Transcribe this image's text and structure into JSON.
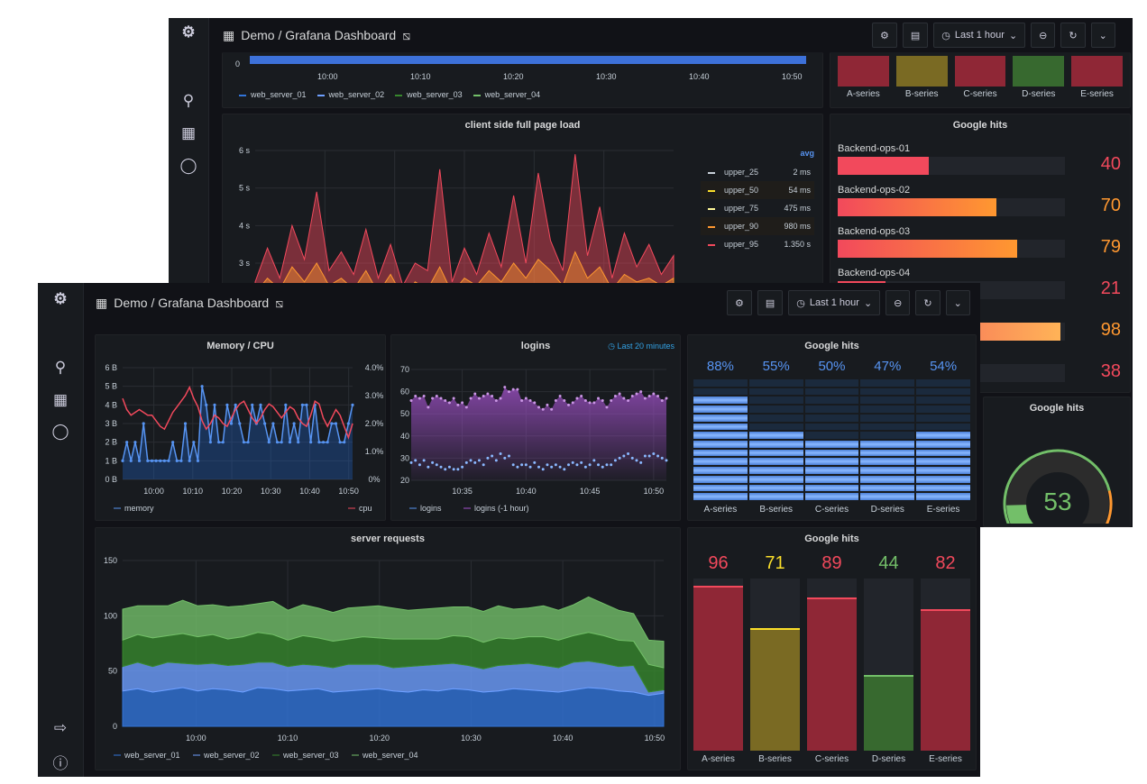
{
  "colors": {
    "bg": "#111217",
    "panel": "#181b1f",
    "blue": "#5794f2",
    "red": "#f2495c",
    "orange": "#ff9830",
    "yellow": "#fade2a",
    "green": "#73bf69",
    "purple": "#a352cc",
    "logo": "#f46800"
  },
  "back": {
    "breadcrumb": "Demo / Grafana Dashboard",
    "time_picker": "Last 1 hour",
    "top_panel": {
      "y_tick": "0",
      "x_ticks": [
        "10:00",
        "10:10",
        "10:20",
        "10:30",
        "10:40",
        "10:50"
      ],
      "legend": [
        "web_server_01",
        "web_server_02",
        "web_server_03",
        "web_server_04"
      ]
    },
    "status_panel": {
      "items": [
        {
          "label": "A-series",
          "color": "#8f2736"
        },
        {
          "label": "B-series",
          "color": "#7a6a23"
        },
        {
          "label": "C-series",
          "color": "#8f2736"
        },
        {
          "label": "D-series",
          "color": "#37692f"
        },
        {
          "label": "E-series",
          "color": "#8f2736"
        }
      ]
    },
    "page_load": {
      "title": "client side full page load",
      "legend_header": "avg",
      "legend": [
        {
          "name": "upper_25",
          "value": "2 ms",
          "color": "#c7d0d9"
        },
        {
          "name": "upper_50",
          "value": "54 ms",
          "color": "#fade2a"
        },
        {
          "name": "upper_75",
          "value": "475 ms",
          "color": "#fff899"
        },
        {
          "name": "upper_90",
          "value": "980 ms",
          "color": "#ff9830"
        },
        {
          "name": "upper_95",
          "value": "1.350 s",
          "color": "#f2495c"
        }
      ],
      "chart_data": {
        "type": "area",
        "y_ticks": [
          "3 s",
          "4 s",
          "5 s",
          "6 s"
        ],
        "ylim": [
          0,
          6
        ],
        "series": [
          {
            "name": "upper_95",
            "values": [
              2.5,
              3.4,
              2.6,
              4.0,
              3.1,
              4.9,
              2.8,
              3.3,
              2.7,
              3.9,
              2.6,
              3.5,
              2.4,
              3.0,
              2.8,
              5.5,
              2.5,
              3.4,
              2.7,
              3.8,
              2.9,
              4.8,
              3.0,
              5.4,
              3.6,
              2.8,
              5.9,
              3.2,
              4.5,
              2.6,
              3.8,
              2.9,
              3.5,
              2.7,
              3.2
            ]
          },
          {
            "name": "upper_90",
            "values": [
              2.2,
              2.6,
              2.3,
              2.9,
              2.5,
              3.0,
              2.4,
              2.6,
              2.3,
              2.8,
              2.2,
              2.7,
              2.1,
              2.5,
              2.3,
              2.9,
              2.2,
              2.6,
              2.4,
              2.8,
              2.5,
              3.0,
              2.6,
              3.1,
              2.8,
              2.4,
              3.3,
              2.6,
              2.9,
              2.3,
              2.7,
              2.5,
              2.6,
              2.4,
              2.6
            ]
          }
        ]
      }
    },
    "bar_gauge": {
      "title": "Google hits",
      "rows": [
        {
          "label": "Backend-ops-01",
          "value": 40
        },
        {
          "label": "Backend-ops-02",
          "value": 70
        },
        {
          "label": "Backend-ops-03",
          "value": 79
        },
        {
          "label": "Backend-ops-04",
          "value": 21
        },
        {
          "label": "",
          "value": 98
        },
        {
          "label": "",
          "value": 38
        }
      ]
    },
    "gauge": {
      "title": "Google hits",
      "value": 53,
      "max": 100
    }
  },
  "front": {
    "breadcrumb": "Demo / Grafana Dashboard",
    "time_picker": "Last 1 hour",
    "memory_cpu": {
      "title": "Memory / CPU",
      "chart_data": {
        "type": "line",
        "time_range": [
          "09:52",
          "10:51"
        ],
        "x_ticks": [
          "10:00",
          "10:10",
          "10:20",
          "10:30",
          "10:40",
          "10:50"
        ],
        "y_left_ticks": [
          "0 B",
          "1 B",
          "2 B",
          "3 B",
          "4 B",
          "5 B",
          "6 B"
        ],
        "ylim_left": [
          0,
          6
        ],
        "y_right_ticks": [
          "0%",
          "1.0%",
          "2.0%",
          "3.0%",
          "4.0%"
        ],
        "ylim_right": [
          0,
          4
        ],
        "series": [
          {
            "name": "memory",
            "axis": "left",
            "values": [
              1,
              2,
              1,
              2,
              1,
              3,
              1,
              1,
              1,
              1,
              1,
              1,
              2,
              1,
              1,
              3,
              1,
              2,
              1,
              5,
              4,
              2,
              4,
              2,
              2,
              4,
              3,
              4,
              3,
              2,
              2,
              4,
              3,
              4,
              3,
              2,
              3,
              2,
              2,
              4,
              2,
              3,
              2,
              4,
              4,
              2,
              4,
              2,
              2,
              2,
              3,
              3,
              2,
              2,
              3,
              4
            ]
          },
          {
            "name": "cpu",
            "axis": "right",
            "values": [
              2.9,
              2.5,
              2.3,
              2.4,
              2.5,
              2.4,
              2.3,
              2.3,
              2.1,
              1.9,
              1.8,
              2.1,
              2.4,
              2.6,
              2.8,
              3.0,
              3.3,
              2.9,
              2.6,
              2.1,
              1.8,
              2.0,
              2.3,
              2.2,
              2.0,
              1.9,
              2.2,
              2.5,
              2.7,
              2.8,
              2.5,
              2.2,
              2.0,
              2.2,
              2.5,
              2.7,
              2.6,
              2.4,
              2.2,
              2.4,
              2.6,
              2.5,
              2.2,
              2.0,
              1.9,
              2.3,
              2.8,
              2.7,
              2.2,
              1.9,
              2.2,
              2.5,
              2.3,
              1.9,
              1.5,
              2.0
            ]
          }
        ]
      }
    },
    "logins": {
      "title": "logins",
      "time_info": "Last 20 minutes",
      "chart_data": {
        "type": "scatter-area",
        "time_range": [
          "10:31",
          "10:51"
        ],
        "x_ticks": [
          "10:35",
          "10:40",
          "10:45",
          "10:50"
        ],
        "y_ticks": [
          "20",
          "30",
          "40",
          "50",
          "60",
          "70"
        ],
        "ylim": [
          20,
          70
        ],
        "series": [
          {
            "name": "logins",
            "values": [
              28,
              29,
              27,
              29,
              26,
              28,
              27,
              26,
              25,
              26,
              25,
              25,
              26,
              28,
              29,
              28,
              29,
              27,
              30,
              31,
              29,
              32,
              30,
              31,
              27,
              26,
              27,
              27,
              26,
              28,
              26,
              25,
              27,
              26,
              27,
              26,
              25,
              27,
              28,
              27,
              28,
              26,
              27,
              29,
              27,
              26,
              27,
              27,
              29,
              30,
              31,
              32,
              30,
              29,
              28,
              31,
              31,
              32,
              31,
              30,
              29
            ]
          },
          {
            "name": "logins (-1 hour)",
            "values": [
              56,
              58,
              57,
              58,
              53,
              57,
              58,
              57,
              56,
              55,
              57,
              54,
              55,
              53,
              57,
              59,
              57,
              58,
              59,
              58,
              56,
              57,
              62,
              60,
              61,
              61,
              56,
              57,
              56,
              55,
              53,
              52,
              54,
              52,
              56,
              58,
              56,
              54,
              55,
              57,
              58,
              56,
              55,
              55,
              57,
              56,
              53,
              56,
              58,
              59,
              57,
              56,
              58,
              59,
              60,
              57,
              58,
              59,
              58,
              56,
              57
            ]
          }
        ]
      }
    },
    "led_gauge": {
      "title": "Google hits",
      "items": [
        {
          "label": "A-series",
          "value": 88
        },
        {
          "label": "B-series",
          "value": 55
        },
        {
          "label": "C-series",
          "value": 50
        },
        {
          "label": "D-series",
          "value": 47
        },
        {
          "label": "E-series",
          "value": 54
        }
      ]
    },
    "server_requests": {
      "title": "server requests",
      "chart_data": {
        "type": "stacked-area",
        "time_range": [
          "09:52",
          "10:51"
        ],
        "x_ticks": [
          "10:00",
          "10:10",
          "10:20",
          "10:30",
          "10:40",
          "10:50"
        ],
        "y_ticks": [
          "0",
          "50",
          "100",
          "150"
        ],
        "ylim": [
          0,
          150
        ],
        "series": [
          {
            "name": "web_server_01",
            "color": "#3274d9",
            "values": [
              32,
              34,
              31,
              33,
              35,
              32,
              34,
              33,
              31,
              35,
              34,
              32,
              33,
              34,
              31,
              32,
              33,
              34,
              32,
              31,
              33,
              32,
              34,
              33,
              31,
              32,
              34,
              33,
              32,
              31,
              33,
              35,
              34,
              32,
              31,
              28,
              30
            ]
          },
          {
            "name": "web_server_02",
            "color": "#6e9fff",
            "values": [
              22,
              24,
              23,
              25,
              22,
              24,
              23,
              22,
              25,
              23,
              24,
              22,
              23,
              21,
              22,
              24,
              23,
              22,
              21,
              23,
              22,
              24,
              23,
              22,
              21,
              23,
              22,
              24,
              23,
              22,
              25,
              24,
              23,
              22,
              24,
              3,
              3
            ]
          },
          {
            "name": "web_server_03",
            "color": "#37872d",
            "values": [
              24,
              25,
              26,
              24,
              27,
              25,
              26,
              24,
              25,
              27,
              25,
              24,
              26,
              25,
              24,
              23,
              25,
              24,
              26,
              25,
              24,
              23,
              25,
              26,
              24,
              25,
              23,
              24,
              26,
              25,
              24,
              26,
              25,
              24,
              22,
              25,
              20
            ]
          },
          {
            "name": "web_server_04",
            "color": "#73bf69",
            "values": [
              28,
              26,
              29,
              27,
              30,
              28,
              27,
              29,
              28,
              26,
              30,
              27,
              28,
              27,
              26,
              28,
              27,
              29,
              28,
              26,
              27,
              28,
              26,
              27,
              28,
              29,
              27,
              26,
              28,
              27,
              28,
              32,
              29,
              27,
              25,
              22,
              24
            ]
          }
        ]
      }
    },
    "bar_panel": {
      "title": "Google hits",
      "items": [
        {
          "label": "A-series",
          "value": 96,
          "color": "#f2495c"
        },
        {
          "label": "B-series",
          "value": 71,
          "color": "#fade2a"
        },
        {
          "label": "C-series",
          "value": 89,
          "color": "#f2495c"
        },
        {
          "label": "D-series",
          "value": 44,
          "color": "#73bf69"
        },
        {
          "label": "E-series",
          "value": 82,
          "color": "#f2495c"
        }
      ]
    }
  }
}
